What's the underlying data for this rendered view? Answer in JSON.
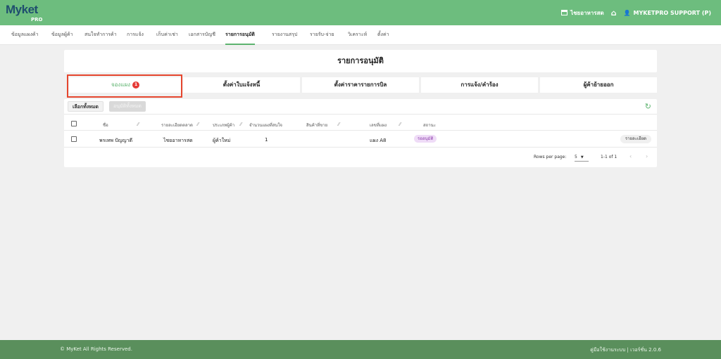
{
  "brand": {
    "logo": "Myket",
    "sub": "PRO"
  },
  "header": {
    "store_label": "ไชยอาหารสด",
    "user_label": "MYKETPRO SUPPORT (P)"
  },
  "nav": {
    "items": [
      {
        "label": "ข้อมูลแผงค้า"
      },
      {
        "label": "ข้อมูลผู้ค้า"
      },
      {
        "label": "สนใจทำการค้า"
      },
      {
        "label": "การแจ้ง"
      },
      {
        "label": "เก็บค่าเช่า"
      },
      {
        "label": "เอกสารบัญชี"
      },
      {
        "label": "รายการอนุมัติ"
      },
      {
        "label": "รายงานสรุป"
      },
      {
        "label": "รายรับ-จ่าย"
      },
      {
        "label": "วิเคราะห์"
      },
      {
        "label": "ตั้งค่า"
      }
    ]
  },
  "page": {
    "title": "รายการอนุมัติ"
  },
  "tabs": [
    {
      "label": "จองแผง",
      "badge": "1"
    },
    {
      "label": "ตั้งค่าใบแจ้งหนี้"
    },
    {
      "label": "ตั้งค่าราคารายการบิล"
    },
    {
      "label": "การแจ้ง/คำร้อง"
    },
    {
      "label": "ผู้ค้าย้ายออก"
    }
  ],
  "toolbar": {
    "select_all": "เลือกทั้งหมด",
    "approve_all": "อนุมัติทั้งหมด"
  },
  "table": {
    "columns": [
      "ชื่อ",
      "รายละเอียดตลาด",
      "ประเภทผู้ค้า",
      "จำนวนแผงที่สนใจ",
      "สินค้าที่ขาย",
      "เลขที่แผง",
      "สถานะ"
    ],
    "rows": [
      {
        "name": "พรเทพ ปัญญาดี",
        "market": "ไชยอาหารสด",
        "type": "ผู้ค้าใหม่",
        "count": "1",
        "product": "",
        "stall": "แผง A8",
        "status": "รออนุมัติ",
        "action": "รายละเอียด"
      }
    ]
  },
  "pagination": {
    "rows_label": "Rows per page:",
    "rows_value": "5",
    "range": "1-1 of 1"
  },
  "footer": {
    "copyright": "© MyKet All Rights Reserved.",
    "version": "คู่มือใช้งานระบบ | เวอร์ชั่น 2.0.6"
  },
  "colors": {
    "primary": "#6dbd7e",
    "footer": "#5a8f5c",
    "highlight": "#e5462e",
    "badge": "#e53935"
  }
}
